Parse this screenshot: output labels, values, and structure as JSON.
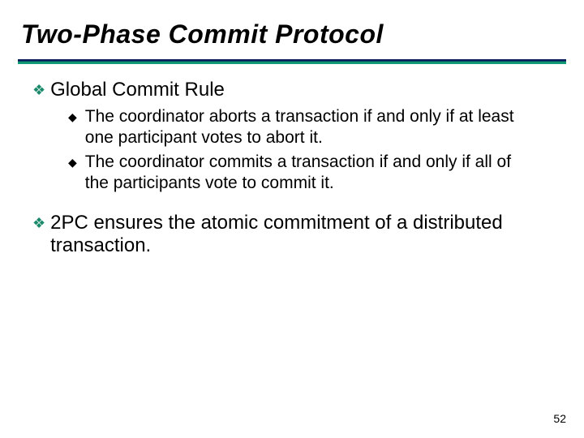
{
  "title": "Two-Phase Commit Protocol",
  "sections": [
    {
      "heading": "Global Commit Rule",
      "items": [
        "The coordinator aborts a transaction if and only if at least one participant votes to abort it.",
        "The coordinator commits a transaction if and only if all of the participants vote to commit it."
      ]
    },
    {
      "heading": "2PC ensures the atomic commitment of a distributed transaction.",
      "items": []
    }
  ],
  "page_number": "52",
  "glyphs": {
    "diamond": "❖",
    "square": "◆"
  }
}
